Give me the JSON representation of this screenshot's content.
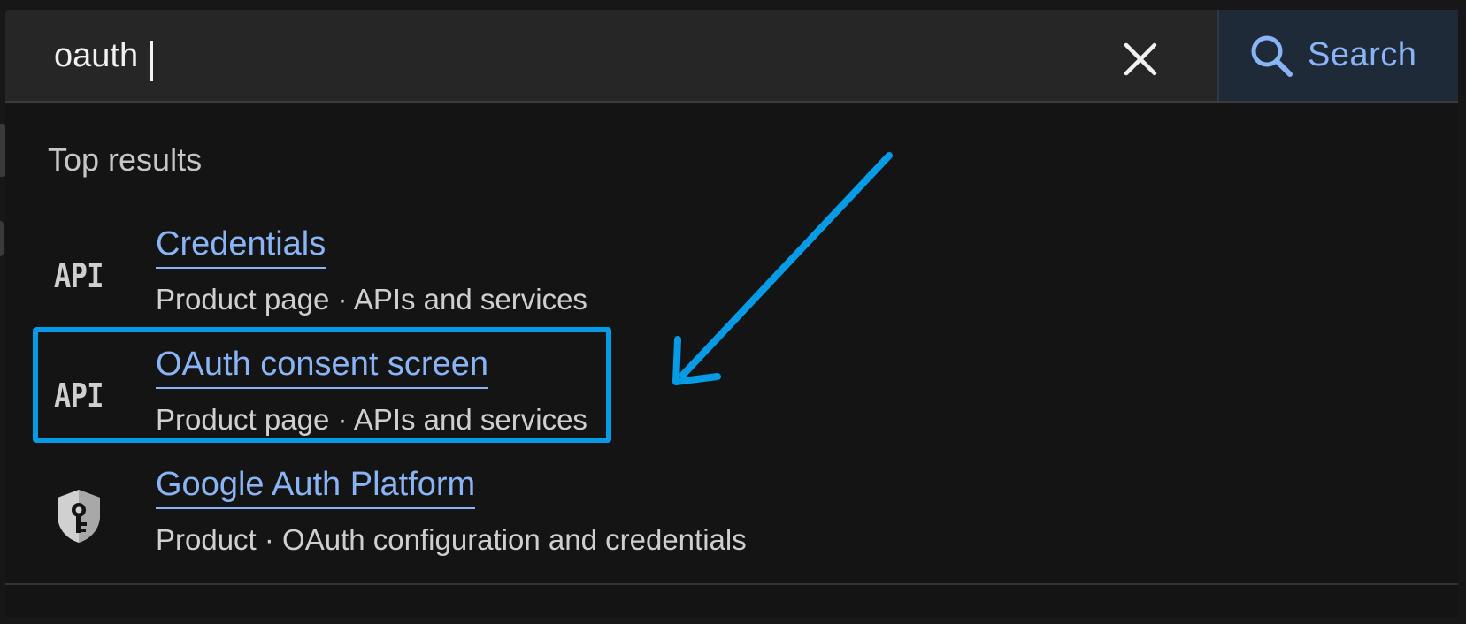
{
  "search": {
    "value": "oauth",
    "clear_icon": "close-icon",
    "button_icon": "search-icon",
    "button_label": "Search",
    "accent_color": "#8ab4f8"
  },
  "dropdown": {
    "section_title": "Top results",
    "results": [
      {
        "icon": "api-icon",
        "icon_text": "API",
        "title": "Credentials",
        "subtitle": "Product page · APIs and services"
      },
      {
        "icon": "api-icon",
        "icon_text": "API",
        "title": "OAuth consent screen",
        "subtitle": "Product page · APIs and services",
        "highlighted": true
      },
      {
        "icon": "shield-key-icon",
        "title": "Google Auth Platform",
        "subtitle": "Product · OAuth configuration and credentials"
      }
    ]
  },
  "annotation": {
    "highlight_color": "#039be5",
    "arrow_icon": "arrow-icon"
  }
}
